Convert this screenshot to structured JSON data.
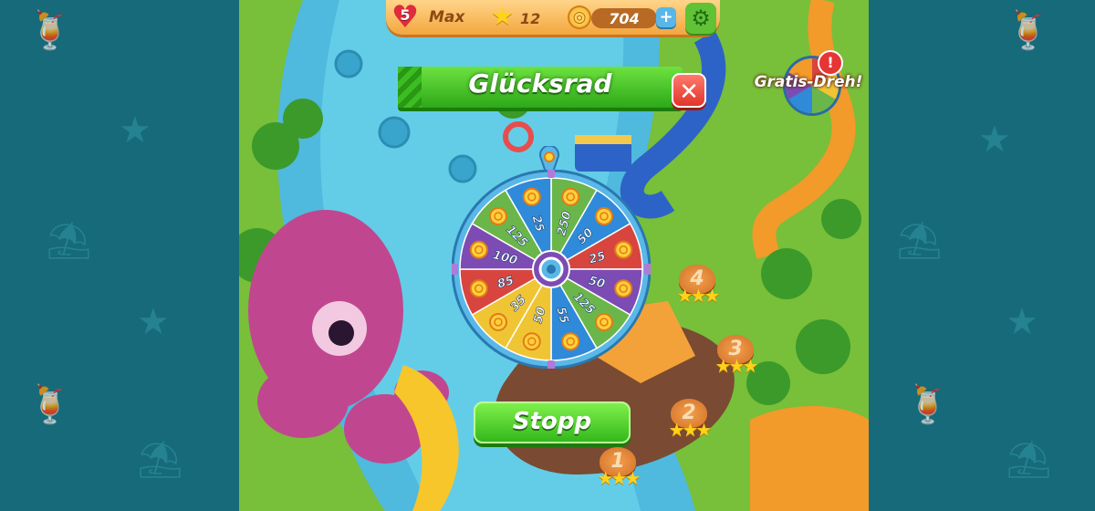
{
  "hud": {
    "lives": "5",
    "player_name": "Max",
    "stars": "12",
    "coins": "704",
    "plus_label": "+",
    "heart_icon": "heart-icon",
    "star_icon": "star-icon",
    "coin_icon": "coin-icon",
    "gear_icon": "gear-icon"
  },
  "free_spin": {
    "label": "Gratis-Dreh!",
    "alert": "!"
  },
  "dialog": {
    "title": "Glücksrad",
    "close_label": "✕",
    "stop_label": "Stopp"
  },
  "wheel": {
    "segments": [
      {
        "value": "250",
        "color": "#6bb64a"
      },
      {
        "value": "50",
        "color": "#2f8ad9"
      },
      {
        "value": "25",
        "color": "#d8453f"
      },
      {
        "value": "50",
        "color": "#7c4bb3"
      },
      {
        "value": "125",
        "color": "#6bb64a"
      },
      {
        "value": "55",
        "color": "#2f8ad9"
      },
      {
        "value": "50",
        "color": "#f0c534"
      },
      {
        "value": "35",
        "color": "#f0c534"
      },
      {
        "value": "85",
        "color": "#d8453f"
      },
      {
        "value": "100",
        "color": "#7c4bb3"
      },
      {
        "value": "125",
        "color": "#6bb64a"
      },
      {
        "value": "25",
        "color": "#2f8ad9"
      }
    ]
  },
  "levels": [
    "1",
    "2",
    "3",
    "4"
  ],
  "colors": {
    "side_bg": "#176a79",
    "banner_green": "#2ea81a",
    "close_red": "#e2352b"
  }
}
